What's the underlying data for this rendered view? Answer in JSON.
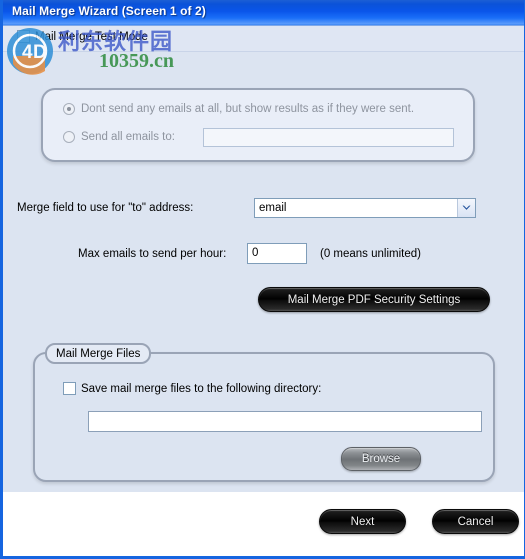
{
  "window": {
    "title": "Mail Merge Wizard (Screen 1 of 2)",
    "accent_color": "#0a55ea",
    "panel_color": "#dce4f1"
  },
  "test_mode": {
    "label": "Mail Merge Test Mode",
    "checked": false
  },
  "send_options": {
    "option_no_send": {
      "label": "Dont send any emails at all, but show results as if they were sent.",
      "selected": true
    },
    "option_send_all": {
      "label": "Send all emails to:",
      "selected": false
    },
    "send_all_value": "",
    "enabled": false
  },
  "merge_field": {
    "label": "Merge field to use for \"to\" address:",
    "value": "email",
    "options": [
      "email"
    ]
  },
  "max_emails": {
    "label": "Max emails to send per hour:",
    "value": "0",
    "hint": "(0 means unlimited)"
  },
  "pdf_security": {
    "label": "Mail Merge PDF Security Settings"
  },
  "files_group": {
    "legend": "Mail Merge Files",
    "save_checkbox_label": "Save mail merge files to the following directory:",
    "save_checked": false,
    "directory_value": "",
    "browse_label": "Browse"
  },
  "footer": {
    "next_label": "Next",
    "cancel_label": "Cancel"
  },
  "watermark": {
    "cn_text": "利东软件园",
    "url_text": "10359.cn",
    "cn_color": "#3a56c8",
    "url_color": "#2e8b3d"
  }
}
